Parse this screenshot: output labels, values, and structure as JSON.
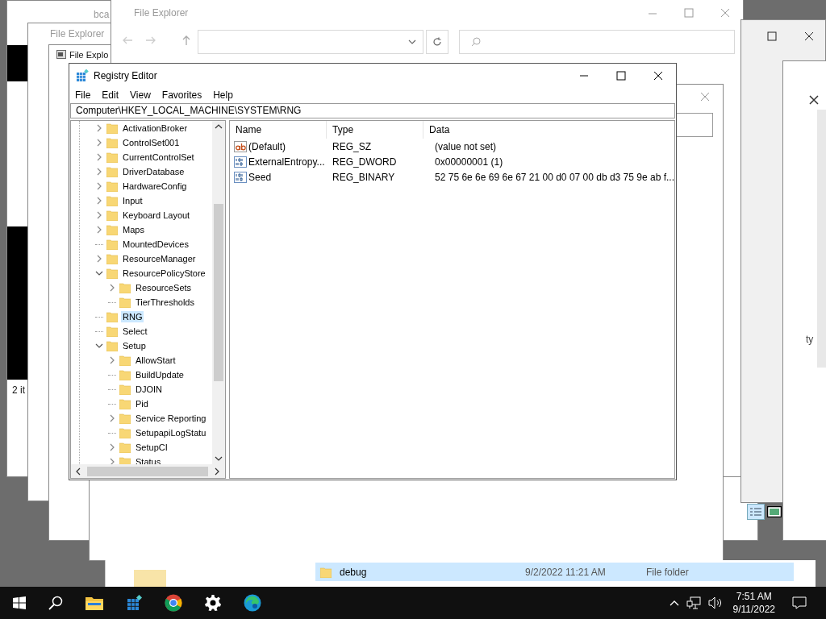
{
  "background_windows": [
    {
      "title": "bca"
    },
    {
      "title": "File Explorer"
    },
    {
      "title": "File Explo"
    },
    {
      "title": "File Explorer"
    }
  ],
  "background_texts": {
    "status": "2 it",
    "column_fragment": "ty"
  },
  "registry_editor": {
    "title": "Registry Editor",
    "menu": [
      "File",
      "Edit",
      "View",
      "Favorites",
      "Help"
    ],
    "address": "Computer\\HKEY_LOCAL_MACHINE\\SYSTEM\\RNG",
    "tree": [
      {
        "label": "ActivationBroker",
        "expandable": true,
        "expanded": false,
        "selected": false
      },
      {
        "label": "ControlSet001",
        "expandable": true,
        "expanded": false,
        "selected": false
      },
      {
        "label": "CurrentControlSet",
        "expandable": true,
        "expanded": false,
        "selected": false
      },
      {
        "label": "DriverDatabase",
        "expandable": true,
        "expanded": false,
        "selected": false
      },
      {
        "label": "HardwareConfig",
        "expandable": true,
        "expanded": false,
        "selected": false
      },
      {
        "label": "Input",
        "expandable": true,
        "expanded": false,
        "selected": false
      },
      {
        "label": "Keyboard Layout",
        "expandable": true,
        "expanded": false,
        "selected": false
      },
      {
        "label": "Maps",
        "expandable": true,
        "expanded": false,
        "selected": false
      },
      {
        "label": "MountedDevices",
        "expandable": false,
        "selected": false
      },
      {
        "label": "ResourceManager",
        "expandable": true,
        "expanded": false,
        "selected": false
      },
      {
        "label": "ResourcePolicyStore",
        "expandable": true,
        "expanded": true,
        "selected": false,
        "children": [
          {
            "label": "ResourceSets",
            "expandable": true,
            "expanded": false,
            "selected": false
          },
          {
            "label": "TierThresholds",
            "expandable": false,
            "selected": false
          }
        ]
      },
      {
        "label": "RNG",
        "expandable": false,
        "selected": true
      },
      {
        "label": "Select",
        "expandable": false,
        "selected": false
      },
      {
        "label": "Setup",
        "expandable": true,
        "expanded": true,
        "selected": false,
        "children": [
          {
            "label": "AllowStart",
            "expandable": true,
            "expanded": false,
            "selected": false
          },
          {
            "label": "BuildUpdate",
            "expandable": false,
            "selected": false
          },
          {
            "label": "DJOIN",
            "expandable": false,
            "selected": false
          },
          {
            "label": "Pid",
            "expandable": false,
            "selected": false
          },
          {
            "label": "Service Reporting",
            "expandable": true,
            "expanded": false,
            "selected": false
          },
          {
            "label": "SetupapiLogStatu",
            "expandable": false,
            "selected": false
          },
          {
            "label": "SetupCI",
            "expandable": true,
            "expanded": false,
            "selected": false
          },
          {
            "label": "Status",
            "expandable": true,
            "expanded": false,
            "selected": false
          }
        ]
      }
    ],
    "columns": [
      "Name",
      "Type",
      "Data"
    ],
    "values": [
      {
        "kind": "string",
        "name": "(Default)",
        "type": "REG_SZ",
        "data": "(value not set)"
      },
      {
        "kind": "binary",
        "name": "ExternalEntropy...",
        "type": "REG_DWORD",
        "data": "0x00000001 (1)"
      },
      {
        "kind": "binary",
        "name": "Seed",
        "type": "REG_BINARY",
        "data": "52 75 6e 6e 69 6e 67 21 00 d0 07 00 db d3 75 9e ab f..."
      }
    ]
  },
  "file_list": {
    "rows": [
      {
        "name": "debug",
        "date": "9/2/2022 11:21 AM",
        "type": "File folder",
        "selected": true
      }
    ]
  },
  "taskbar": {
    "time": "7:51 AM",
    "date": "9/11/2022"
  }
}
